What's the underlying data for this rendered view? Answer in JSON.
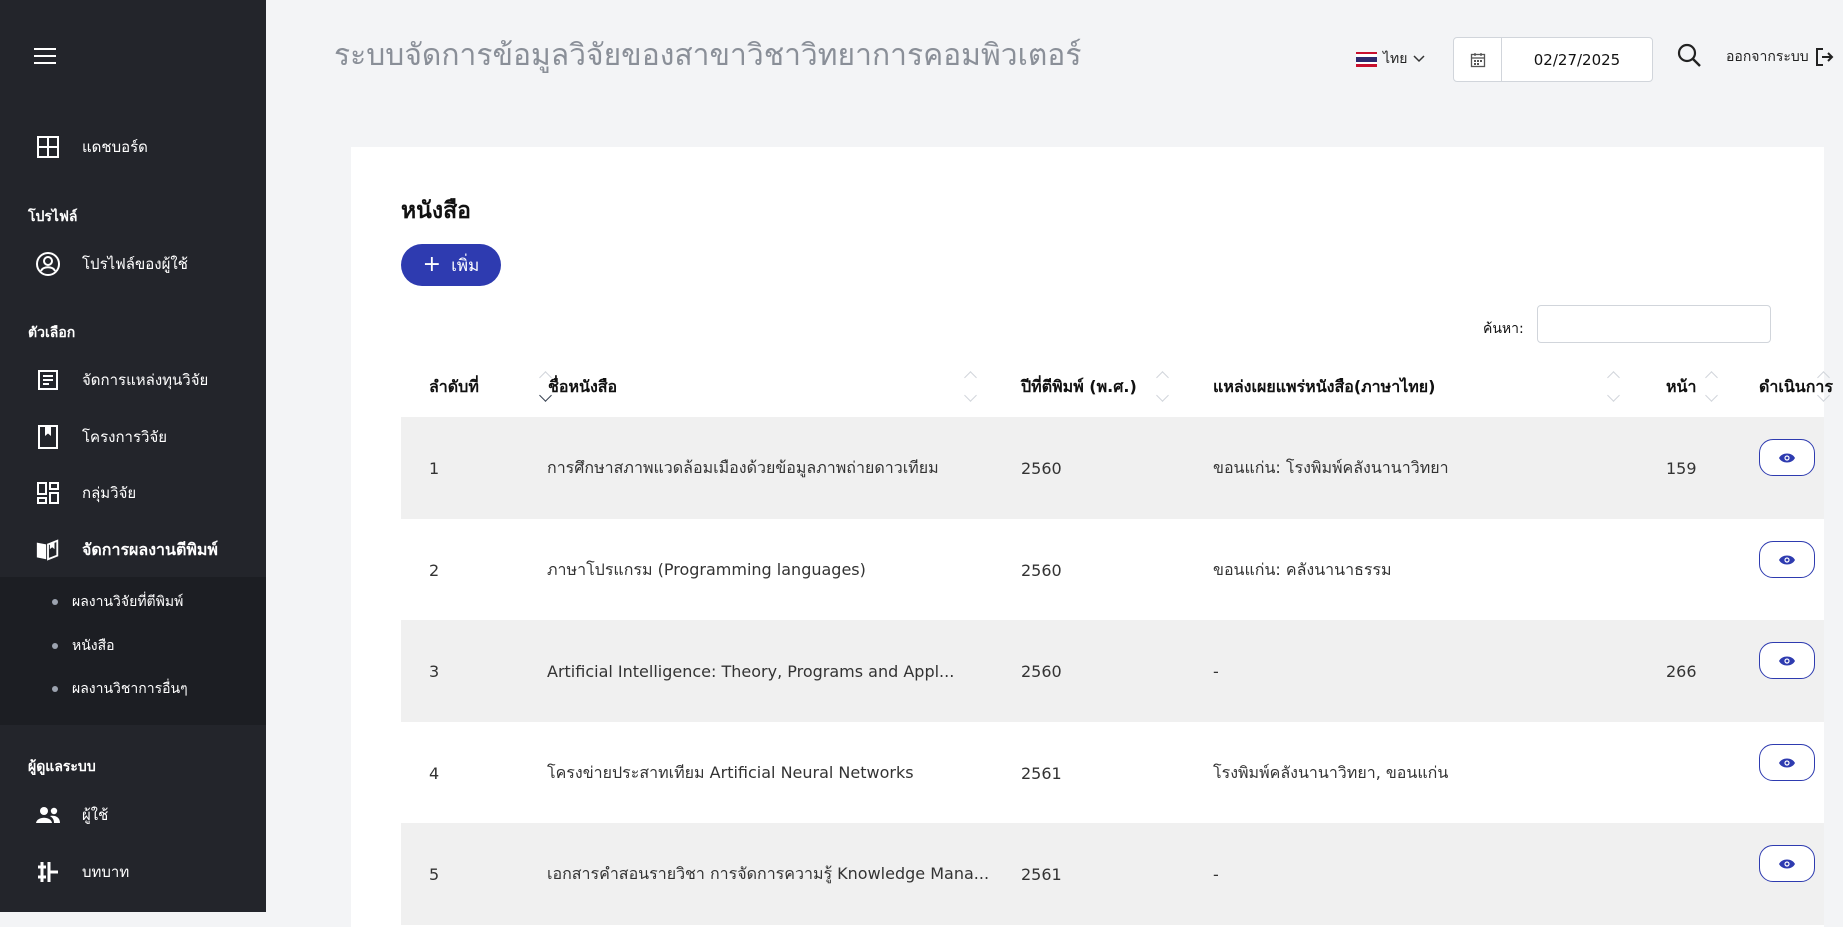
{
  "app_title": "ระบบจัดการข้อมูลวิจัยของสาขาวิชาวิทยาการคอมพิวเตอร์",
  "sidebar": {
    "dashboard": "แดชบอร์ด",
    "section_profile": "โปรไฟล์",
    "user_profile": "โปรไฟล์ของผู้ใช้",
    "section_options": "ตัวเลือก",
    "funding": "จัดการแหล่งทุนวิจัย",
    "projects": "โครงการวิจัย",
    "research_groups": "กลุ่มวิจัย",
    "publications": "จัดการผลงานตีพิมพ์",
    "sub_items": [
      "ผลงานวิจัยที่ตีพิมพ์",
      "หนังสือ",
      "ผลงานวิชาการอื่นๆ"
    ],
    "section_admin": "ผู้ดูแลระบบ",
    "users": "ผู้ใช้",
    "roles": "บทบาท"
  },
  "header": {
    "language": "ไทย",
    "date": "02/27/2025",
    "logout": "ออกจากระบบ"
  },
  "page": {
    "title": "หนังสือ",
    "add_label": "เพิ่ม",
    "search_label": "ค้นหา:",
    "search_value": ""
  },
  "table": {
    "columns": [
      "ลำดับที่",
      "ชื่อหนังสือ",
      "ปีที่ตีพิมพ์ (พ.ศ.)",
      "แหล่งเผยแพร่หนังสือ(ภาษาไทย)",
      "หน้า",
      "ดำเนินการ"
    ],
    "rows": [
      {
        "no": "1",
        "title": "การศึกษาสภาพแวดล้อมเมืองด้วยข้อมูลภาพถ่ายดาวเทียม",
        "year": "2560",
        "source": "ขอนแก่น: โรงพิมพ์คลังนานาวิทยา",
        "pages": "159"
      },
      {
        "no": "2",
        "title": "ภาษาโปรแกรม (Programming languages)",
        "year": "2560",
        "source": "ขอนแก่น: คลังนานาธรรม",
        "pages": ""
      },
      {
        "no": "3",
        "title": "Artificial Intelligence: Theory, Programs and Appl...",
        "year": "2560",
        "source": "-",
        "pages": "266"
      },
      {
        "no": "4",
        "title": "โครงข่ายประสาทเทียม Artificial Neural Networks",
        "year": "2561",
        "source": "โรงพิมพ์คลังนานาวิทยา, ขอนแก่น",
        "pages": ""
      },
      {
        "no": "5",
        "title": "เอกสารคำสอนรายวิชา การจัดการความรู้ Knowledge Mana...",
        "year": "2561",
        "source": "-",
        "pages": ""
      }
    ]
  },
  "colors": {
    "sidebar_bg": "#23252b",
    "accent": "#2e3bb0",
    "row_stripe": "#f0f0f0"
  },
  "icons": {
    "view": "eye-icon",
    "dashboard": "grid-icon",
    "profile": "user-circle-icon",
    "funding": "document-icon",
    "projects": "bookmark-icon",
    "groups": "dashboard-tiles-icon",
    "publications": "open-book-icon",
    "users": "people-icon",
    "roles": "sliders-icon"
  }
}
